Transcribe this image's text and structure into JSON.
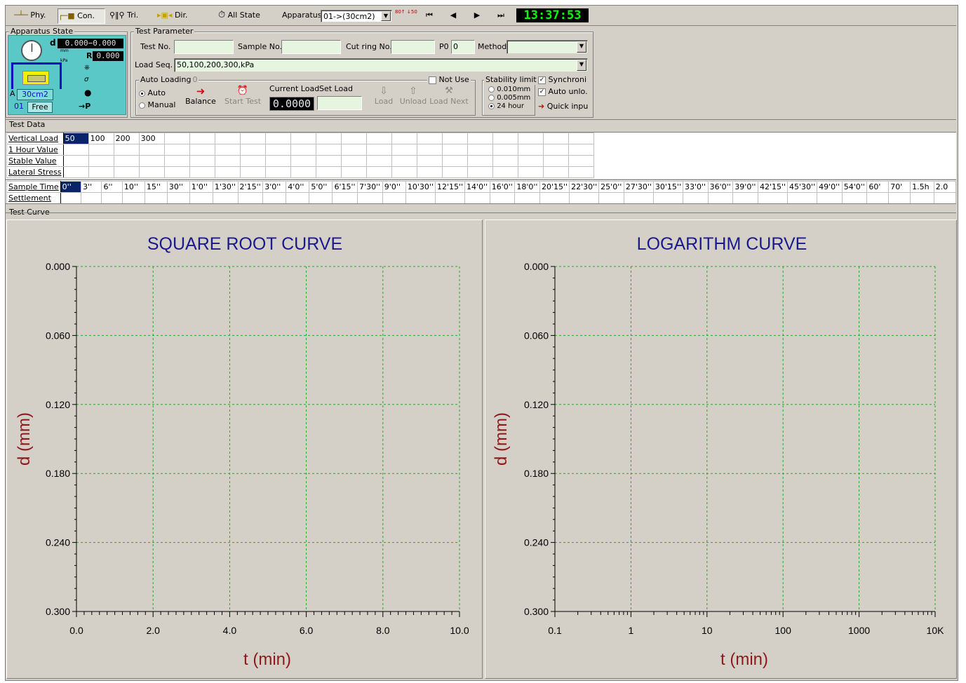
{
  "toolbar": {
    "buttons": [
      {
        "name": "phy",
        "label": "Phy."
      },
      {
        "name": "con",
        "label": "Con."
      },
      {
        "name": "tri",
        "label": "Tri."
      },
      {
        "name": "dir",
        "label": "Dir."
      }
    ],
    "all_state_label": "All State",
    "apparatus_label": "Apparatus",
    "apparatus_value": "01->(30cm2)",
    "speed_icon_text": "80↑ ↓50",
    "clock": "13:37:53"
  },
  "apparatus_state": {
    "title": "Apparatus State",
    "d_label": "d",
    "d_value": "0.000−0.000",
    "d_unit": "mm",
    "r_label": "R",
    "r_value": "0.000",
    "r_unit": "kPa",
    "a_label": "A",
    "area_value": "30cm2",
    "unit_no": "01",
    "status": "Free",
    "p_label": "→P"
  },
  "test_parameter": {
    "title": "Test Parameter",
    "test_no_label": "Test No.",
    "test_no": "",
    "sample_no_label": "Sample No.",
    "sample_no": "",
    "cut_ring_label": "Cut ring No.",
    "cut_ring": "",
    "p0_label": "P0",
    "p0_value": "0",
    "method_label": "Method",
    "method_value": "",
    "load_seq_label": "Load Seq.",
    "load_seq_value": "50,100,200,300,kPa"
  },
  "auto_loading": {
    "title": "Auto Loading",
    "title_suffix": "0",
    "auto_label": "Auto",
    "manual_label": "Manual",
    "balance_label": "Balance",
    "start_test_label": "Start Test",
    "current_load_label": "Current Load",
    "current_load_value": "0.0000",
    "set_load_label": "Set Load",
    "set_load_value": "",
    "not_use_label": "Not Use",
    "load_label": "Load",
    "unload_label": "Unload",
    "load_next_label": "Load Next"
  },
  "stability": {
    "title": "Stability limit",
    "opt1": "0.010mm",
    "opt2": "0.005mm",
    "opt3": "24 hour"
  },
  "right_options": {
    "synchroni": "Synchroni",
    "auto_unlo": "Auto unlo.",
    "quick_input": "Quick inpu"
  },
  "test_data": {
    "title": "Test Data",
    "rows": [
      "Vertical Load",
      "1 Hour Value",
      "Stable  Value",
      "Lateral Stress"
    ],
    "loads": [
      "50",
      "100",
      "200",
      "300"
    ],
    "sample_time_label": "Sample Time",
    "settlement_label": "Settlement",
    "times": [
      "0''",
      "3''",
      "6''",
      "10''",
      "15''",
      "30''",
      "1'0''",
      "1'30''",
      "2'15''",
      "3'0''",
      "4'0''",
      "5'0''",
      "6'15''",
      "7'30''",
      "9'0''",
      "10'30''",
      "12'15''",
      "14'0''",
      "16'0''",
      "18'0''",
      "20'15''",
      "22'30''",
      "25'0''",
      "27'30''",
      "30'15''",
      "33'0''",
      "36'0''",
      "39'0''",
      "42'15''",
      "45'30''",
      "49'0''",
      "54'0''",
      "60'",
      "70'",
      "1.5h",
      "2.0"
    ]
  },
  "test_curve": {
    "title": "Test Curve"
  },
  "chart_data": [
    {
      "type": "line",
      "title": "SQUARE ROOT CURVE",
      "xlabel": "t (min)",
      "ylabel": "d (mm)",
      "xlim": [
        0,
        10
      ],
      "ylim": [
        0.3,
        0
      ],
      "x_ticks": [
        "0.0",
        "2.0",
        "4.0",
        "6.0",
        "8.0",
        "10.0"
      ],
      "y_ticks": [
        "0.000",
        "0.060",
        "0.120",
        "0.180",
        "0.240",
        "0.300"
      ],
      "grid": true,
      "series": []
    },
    {
      "type": "line",
      "title": "LOGARITHM CURVE",
      "xlabel": "t (min)",
      "ylabel": "d (mm)",
      "x_scale": "log",
      "xlim": [
        0.1,
        10000
      ],
      "ylim": [
        0.3,
        0
      ],
      "x_ticks": [
        "0.1",
        "1",
        "10",
        "100",
        "1000",
        "10K"
      ],
      "y_ticks": [
        "0.000",
        "0.060",
        "0.120",
        "0.180",
        "0.240",
        "0.300"
      ],
      "grid": true,
      "series": []
    }
  ],
  "colors": {
    "title_blue": "#1a1a8c",
    "axis_label_red": "#8c1a1a",
    "grid_green": "#22aa22",
    "panel_teal": "#5bc8c8",
    "lcd_green": "#00ff00"
  }
}
